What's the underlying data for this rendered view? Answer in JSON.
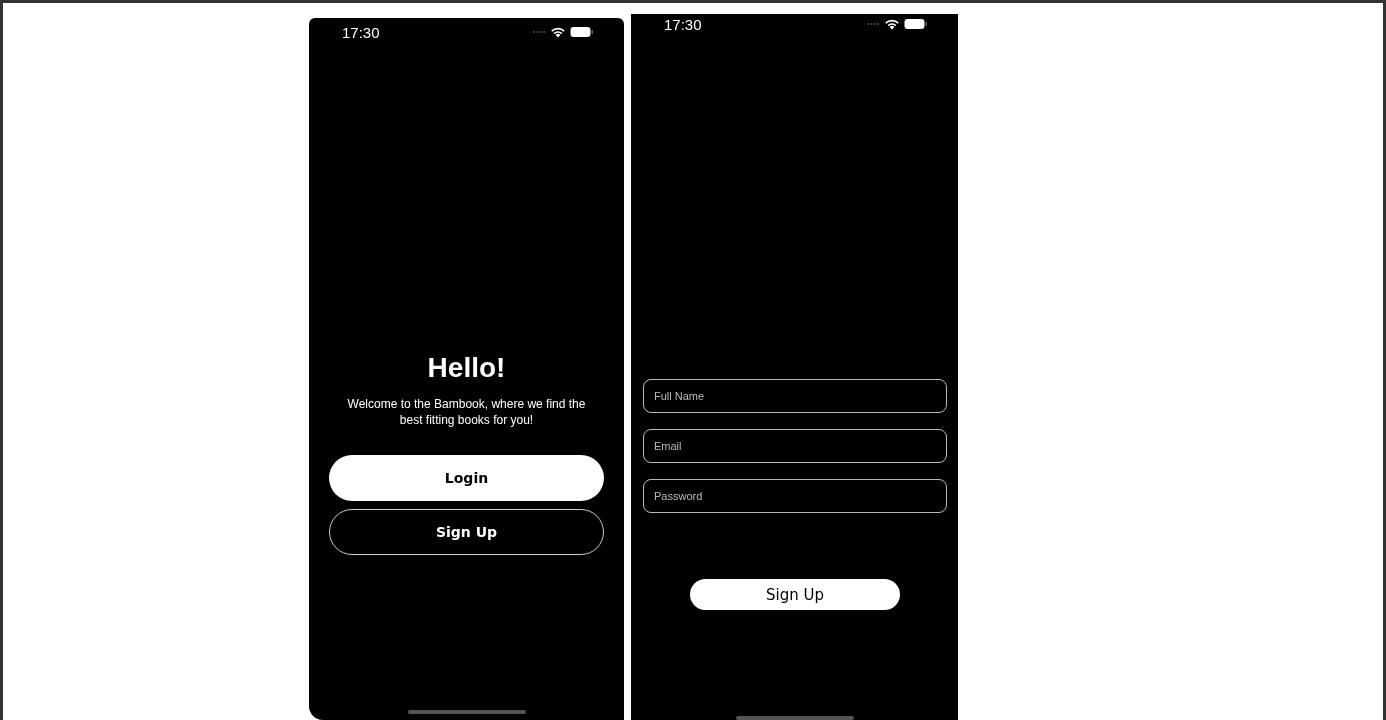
{
  "screens": [
    {
      "kind": "welcome",
      "status_time": "17:30",
      "title": "Hello!",
      "subtitle": "Welcome to the Bambook, where we find the best fitting books for you!",
      "buttons": [
        {
          "label": "Login",
          "kind": "filled"
        },
        {
          "label": "Sign Up",
          "kind": "outline"
        }
      ]
    },
    {
      "kind": "signup",
      "status_time": "17:30",
      "fields": [
        {
          "placeholder": "Full Name"
        },
        {
          "placeholder": "Email"
        },
        {
          "placeholder": "Password"
        }
      ],
      "buttons": [
        {
          "label": "Sign Up",
          "kind": "filled"
        }
      ]
    }
  ]
}
